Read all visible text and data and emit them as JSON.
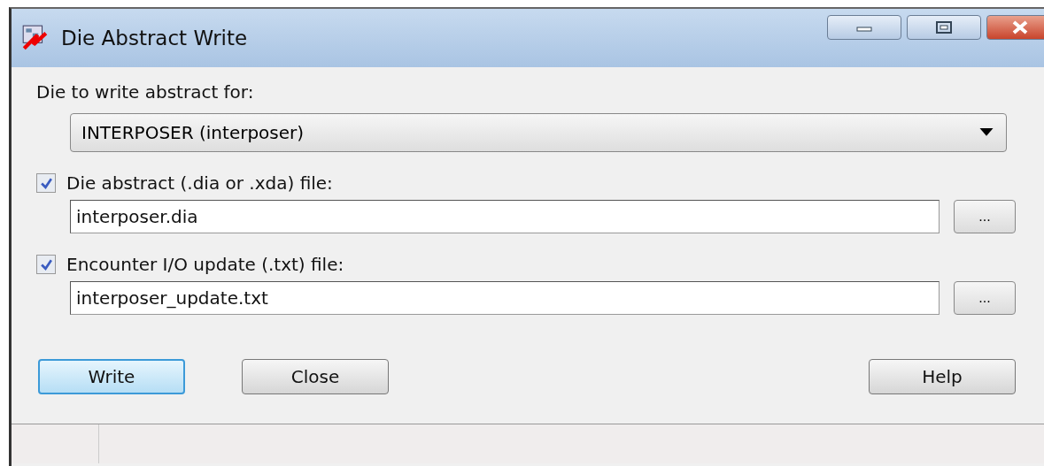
{
  "window": {
    "title": "Die Abstract Write"
  },
  "die_label": "Die to write abstract for:",
  "die_select": {
    "value": "INTERPOSER (interposer)"
  },
  "files": [
    {
      "label": "Die abstract (.dia or .xda) file:",
      "checked": true,
      "value": "interposer.dia",
      "browse": "..."
    },
    {
      "label": "Encounter I/O update (.txt) file:",
      "checked": true,
      "value": "interposer_update.txt",
      "browse": "..."
    }
  ],
  "buttons": [
    {
      "label": "Write",
      "default": true
    },
    {
      "label": "Close",
      "default": false
    },
    {
      "label": "Help",
      "default": false
    }
  ]
}
